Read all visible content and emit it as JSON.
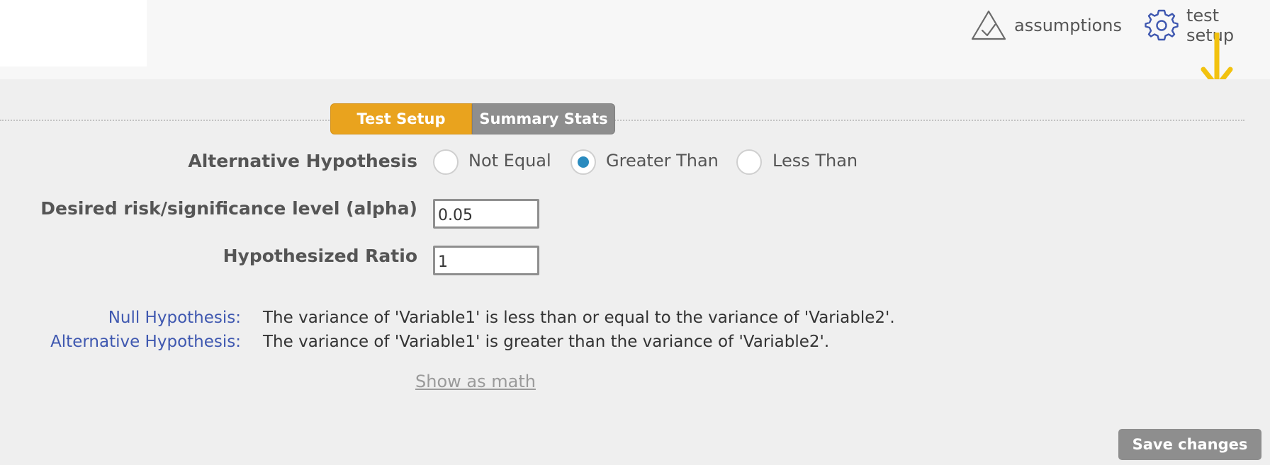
{
  "header": {
    "assumptions_label": "assumptions",
    "test_setup_label": "test setup"
  },
  "tabs": [
    {
      "label": "Test Setup",
      "active": true
    },
    {
      "label": "Summary Stats",
      "active": false
    }
  ],
  "form": {
    "alt_hypothesis_label": "Alternative Hypothesis",
    "options": [
      {
        "label": "Not Equal",
        "selected": false
      },
      {
        "label": "Greater Than",
        "selected": true
      },
      {
        "label": "Less Than",
        "selected": false
      }
    ],
    "alpha_label": "Desired risk/significance level (alpha)",
    "alpha_value": "0.05",
    "ratio_label": "Hypothesized Ratio",
    "ratio_value": "1"
  },
  "hypotheses": {
    "null_label": "Null Hypothesis:",
    "null_text": "The variance of 'Variable1' is less than or equal to the variance of 'Variable2'.",
    "alt_label": "Alternative Hypothesis:",
    "alt_text": "The variance of 'Variable1' is greater than the variance of 'Variable2'."
  },
  "show_math_label": "Show as math",
  "save_label": "Save changes",
  "colors": {
    "accent": "#e9a31e",
    "arrow": "#f2c20f",
    "radio_checked": "#2a8bbf",
    "hypothesis_label": "#3f58b0"
  }
}
